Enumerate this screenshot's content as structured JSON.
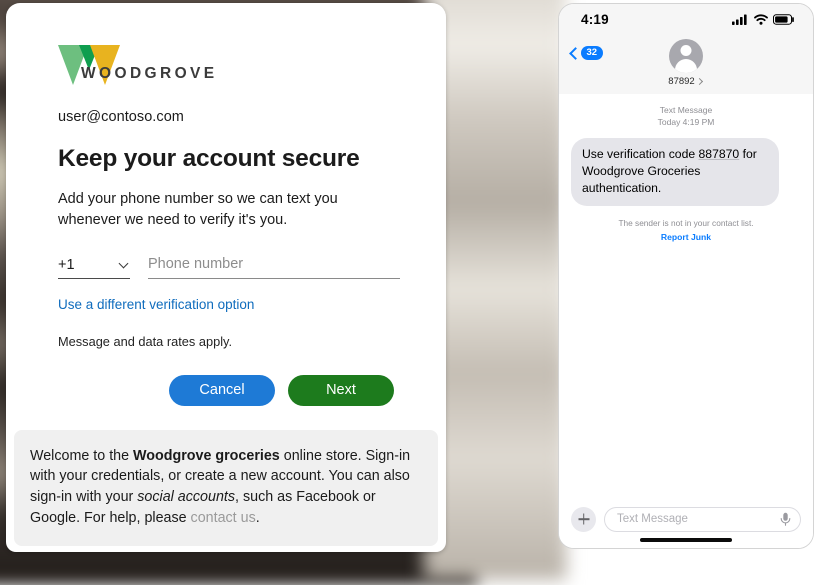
{
  "signin": {
    "logo": {
      "wordmark": "WOODGROVE",
      "icon": "woodgrove-w-logo",
      "colors": {
        "light_green": "#6dbf7f",
        "dark_green": "#0f9e4f",
        "gold": "#e8b31f"
      }
    },
    "user_email": "user@contoso.com",
    "title": "Keep your account secure",
    "description": "Add your phone number so we can text you whenever we need to verify it's you.",
    "country_code": "+1",
    "phone_placeholder": "Phone number",
    "phone_value": "",
    "alt_option_link": "Use a different verification option",
    "rates_note": "Message and data rates apply.",
    "buttons": {
      "cancel": "Cancel",
      "next": "Next",
      "cancel_color": "#1e7ad6",
      "next_color": "#1d7b1d"
    },
    "footer": {
      "part1": "Welcome to the ",
      "bold1": "Woodgrove groceries",
      "part2": " online store. Sign-in with your credentials, or create a new account. You can also sign-in with your ",
      "italic1": "social accounts",
      "part3": ", such as Facebook or Google. For help, please ",
      "link": "contact us",
      "part4": "."
    }
  },
  "phone": {
    "status": {
      "time": "4:19",
      "signal_icon": "cellular-signal-icon",
      "wifi_icon": "wifi-icon",
      "battery_icon": "battery-icon"
    },
    "header": {
      "back_icon": "back-chevron-icon",
      "unread_badge": "32",
      "avatar_icon": "contact-avatar-icon",
      "contact_name": "87892",
      "detail_chevron": "chevron-right-icon"
    },
    "thread": {
      "meta_line1": "Text Message",
      "meta_line2": "Today 4:19 PM",
      "message_pre": "Use verification code ",
      "message_code": "887870",
      "message_post": " for Woodgrove Groceries authentication.",
      "sender_note": "The sender is not in your contact list.",
      "report_junk": "Report Junk"
    },
    "composer": {
      "plus_icon": "plus-icon",
      "placeholder": "Text Message",
      "mic_icon": "microphone-icon"
    }
  }
}
